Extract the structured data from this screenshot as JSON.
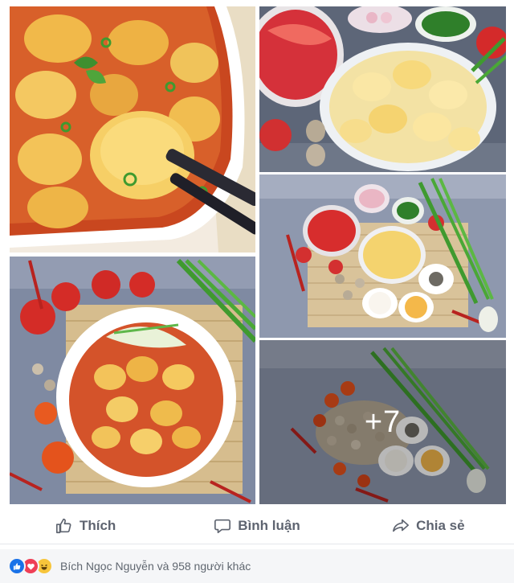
{
  "photos": {
    "more_count": "+7"
  },
  "actions": {
    "like_label": "Thích",
    "comment_label": "Bình luận",
    "share_label": "Chia sẻ"
  },
  "reactions": {
    "summary": "Bích Ngọc Nguyễn và 958 người khác"
  },
  "colors": {
    "like_blue": "#1a72e8",
    "love_red": "#ef3f56",
    "haha_yellow": "#f7c53b",
    "action_gray": "#5e6470"
  }
}
